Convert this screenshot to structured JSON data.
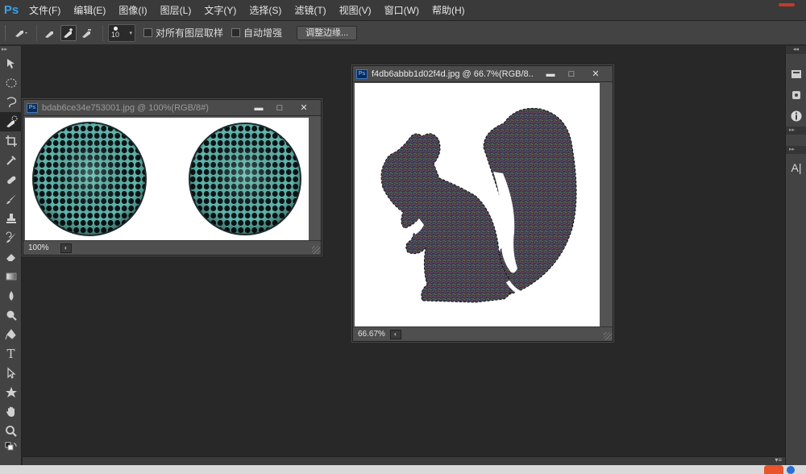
{
  "app": {
    "logo": "Ps",
    "accent_color": "#c23b2a"
  },
  "menu": {
    "items": [
      "文件(F)",
      "编辑(E)",
      "图像(I)",
      "图层(L)",
      "文字(Y)",
      "选择(S)",
      "滤镜(T)",
      "视图(V)",
      "窗口(W)",
      "帮助(H)"
    ]
  },
  "options": {
    "brush_size": "10",
    "sample_all_layers_label": "对所有图层取样",
    "sample_all_layers_checked": false,
    "auto_enhance_label": "自动增强",
    "auto_enhance_checked": false,
    "refine_edge_label": "调整边缘..."
  },
  "toolbox": {
    "header": "▸▸",
    "tools": [
      "move-tool",
      "marquee-tool",
      "lasso-tool",
      "quick-selection-tool",
      "crop-tool",
      "eyedropper-tool",
      "healing-brush-tool",
      "brush-tool",
      "clone-stamp-tool",
      "history-brush-tool",
      "eraser-tool",
      "gradient-tool",
      "blur-tool",
      "dodge-tool",
      "pen-tool",
      "type-tool",
      "path-selection-tool",
      "shape-tool",
      "hand-tool",
      "zoom-tool"
    ],
    "type_glyph": "T"
  },
  "docs": [
    {
      "title": "bdab6ce34e753001.jpg @ 100%(RGB/8#)",
      "zoom": "100%",
      "active": false
    },
    {
      "title": "f4db6abbb1d02f4d.jpg @ 66.7%(RGB/8...",
      "zoom": "66.67%",
      "active": true
    }
  ],
  "window_buttons": {
    "minimize": "▬",
    "maximize": "□",
    "close": "✕"
  },
  "right_panel": {
    "char_glyph": "A|",
    "info_glyph": "i"
  }
}
